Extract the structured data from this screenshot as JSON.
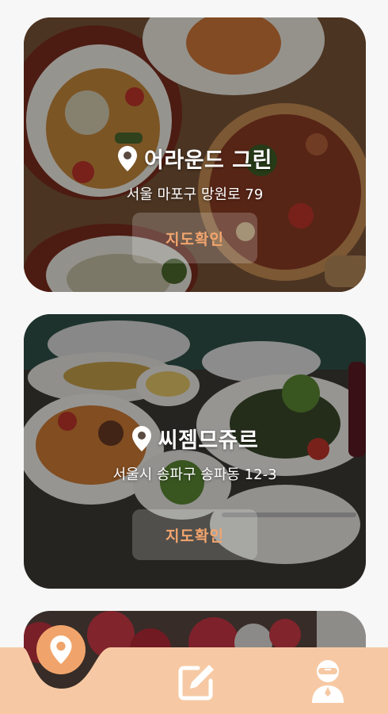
{
  "colors": {
    "accent": "#f0a46b",
    "nav_bg": "#f6c9a4",
    "button_text": "#f3a56d"
  },
  "restaurants": [
    {
      "name": "어라운드 그린",
      "address": "서울 마포구 망원로 79",
      "map_button_label": "지도확인",
      "icon": "location-pin-icon"
    },
    {
      "name": "씨젬므쥬르",
      "address": "서울시 송파구 송파동 12-3",
      "map_button_label": "지도확인",
      "icon": "location-pin-icon"
    }
  ],
  "bottom_nav": {
    "items": [
      {
        "name": "home",
        "icon": "location-pin-icon",
        "active": true
      },
      {
        "name": "write",
        "icon": "edit-icon",
        "active": false
      },
      {
        "name": "profile",
        "icon": "user-icon",
        "active": false
      }
    ]
  }
}
